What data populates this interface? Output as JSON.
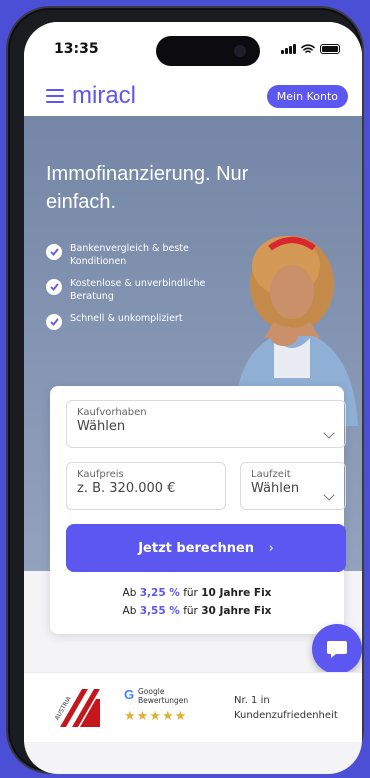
{
  "status": {
    "time": "13:35"
  },
  "nav": {
    "logo": "miracl",
    "account_label": "Mein Konto"
  },
  "hero": {
    "title": "Immofinanzierung. Nur einfach.",
    "bullets": [
      "Bankenvergleich & beste Konditionen",
      "Kostenlose & unverbindliche Beratung",
      "Schnell & unkompliziert"
    ]
  },
  "form": {
    "purpose": {
      "label": "Kaufvorhaben",
      "value": "Wählen"
    },
    "price": {
      "label": "Kaufpreis",
      "placeholder": "z. B. 320.000 €"
    },
    "term": {
      "label": "Laufzeit",
      "value": "Wählen"
    },
    "cta_label": "Jetzt berechnen",
    "rate1": {
      "prefix": "Ab",
      "rate": "3,25 %",
      "mid": "für",
      "term": "10 Jahre Fix"
    },
    "rate2": {
      "prefix": "Ab",
      "rate": "3,55 %",
      "mid": "für",
      "term": "30 Jahre Fix"
    }
  },
  "footer": {
    "badge_text": "AUSTRIA",
    "google_line1": "Google",
    "google_line2": "Bewertungen",
    "rating_stars": 5,
    "nr_line1": "Nr. 1 in",
    "nr_line2": "Kundenzufriedenheit"
  },
  "colors": {
    "accent": "#5b57f0",
    "background": "#4b4fd6",
    "star": "#e2b133"
  }
}
